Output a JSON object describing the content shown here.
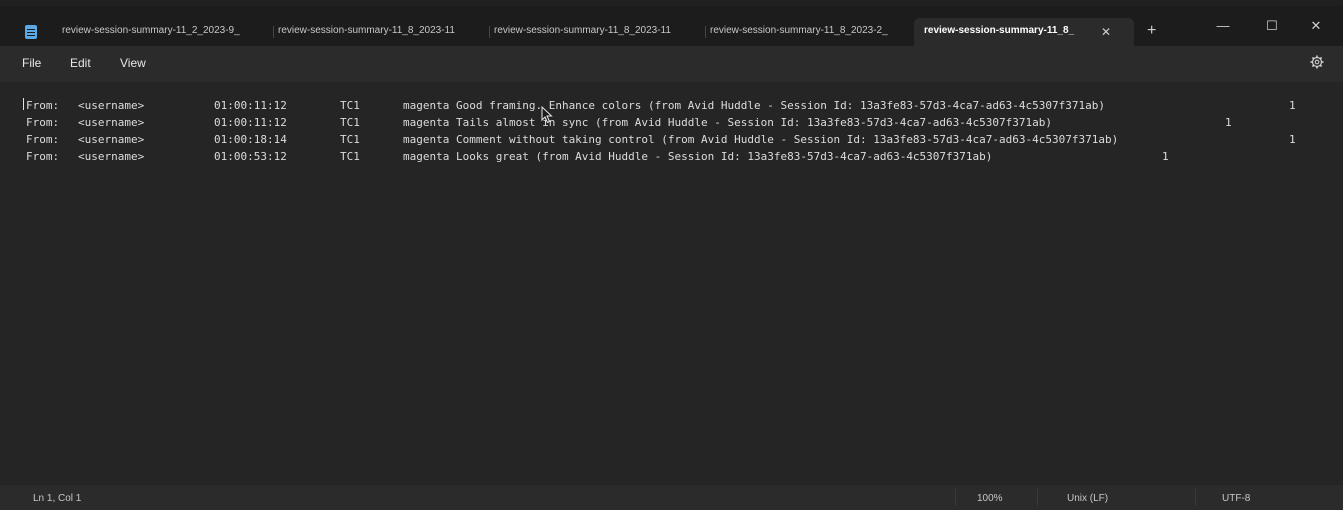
{
  "tabs": [
    {
      "label": "review-session-summary-11_2_2023-9_"
    },
    {
      "label": "review-session-summary-11_8_2023-11"
    },
    {
      "label": "review-session-summary-11_8_2023-11"
    },
    {
      "label": "review-session-summary-11_8_2023-2_"
    },
    {
      "label": "review-session-summary-11_8_",
      "active": true
    }
  ],
  "tab_close_glyph": "✕",
  "new_tab_glyph": "+",
  "window_controls": {
    "minimize": "—",
    "maximize": "☐",
    "close": "✕"
  },
  "menu": {
    "file": "File",
    "edit": "Edit",
    "view": "View"
  },
  "lines": [
    {
      "from": "From:",
      "user": "<username>",
      "time": "01:00:11:12",
      "tc": "TC1",
      "text": "magenta Good framing. Enhance colors (from Avid Huddle - Session Id: 13a3fe83-57d3-4ca7-ad63-4c5307f371ab)",
      "count": "1"
    },
    {
      "from": "From:",
      "user": "<username>",
      "time": "01:00:11:12",
      "tc": "TC1",
      "text": "magenta Tails almost in sync (from Avid Huddle - Session Id: 13a3fe83-57d3-4ca7-ad63-4c5307f371ab)",
      "count": "1"
    },
    {
      "from": "From:",
      "user": "<username>",
      "time": "01:00:18:14",
      "tc": "TC1",
      "text": "magenta Comment without taking control (from Avid Huddle - Session Id: 13a3fe83-57d3-4ca7-ad63-4c5307f371ab)",
      "count": "1"
    },
    {
      "from": "From:",
      "user": "<username>",
      "time": "01:00:53:12",
      "tc": "TC1",
      "text": "magenta Looks great (from Avid Huddle - Session Id: 13a3fe83-57d3-4ca7-ad63-4c5307f371ab)",
      "count": "1"
    }
  ],
  "status": {
    "position": "Ln 1, Col 1",
    "zoom": "100%",
    "line_endings": "Unix (LF)",
    "encoding": "UTF-8"
  }
}
